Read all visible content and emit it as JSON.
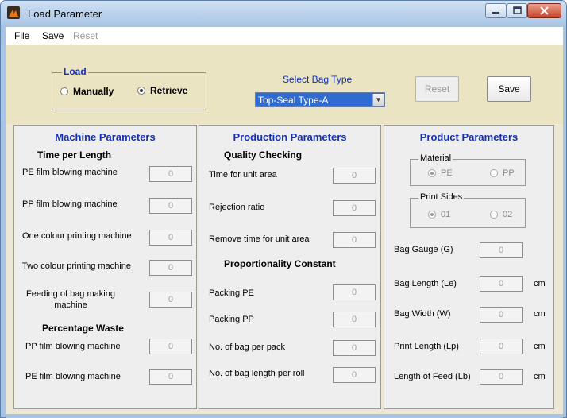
{
  "window": {
    "title": "Load Parameter"
  },
  "menu": {
    "file": "File",
    "save": "Save",
    "reset": "Reset"
  },
  "load": {
    "title": "Load",
    "options": [
      {
        "label": "Manually",
        "selected": false
      },
      {
        "label": "Retrieve",
        "selected": true
      }
    ]
  },
  "bag_type": {
    "label": "Select Bag Type",
    "selected": "Top-Seal Type-A"
  },
  "buttons": {
    "reset": "Reset",
    "save": "Save"
  },
  "machine": {
    "title": "Machine Parameters",
    "time_heading": "Time per Length",
    "time_rows": [
      {
        "label": "PE film blowing machine",
        "value": "0"
      },
      {
        "label": "PP film blowing machine",
        "value": "0"
      },
      {
        "label": "One colour printing machine",
        "value": "0"
      },
      {
        "label": "Two colour printing machine",
        "value": "0"
      },
      {
        "label": "Feeding of bag making machine",
        "value": "0"
      }
    ],
    "waste_heading": "Percentage Waste",
    "waste_rows": [
      {
        "label": "PP film blowing machine",
        "value": "0"
      },
      {
        "label": "PE film blowing machine",
        "value": "0"
      }
    ]
  },
  "production": {
    "title": "Production Parameters",
    "quality_heading": "Quality Checking",
    "quality_rows": [
      {
        "label": "Time for unit area",
        "value": "0"
      },
      {
        "label": "Rejection ratio",
        "value": "0"
      },
      {
        "label": "Remove time for unit area",
        "value": "0"
      }
    ],
    "prop_heading": "Proportionality Constant",
    "prop_rows": [
      {
        "label": "Packing PE",
        "value": "0"
      },
      {
        "label": "Packing PP",
        "value": "0"
      },
      {
        "label": "No. of bag per pack",
        "value": "0"
      },
      {
        "label": "No. of bag length per roll",
        "value": "0"
      }
    ]
  },
  "product": {
    "title": "Product Parameters",
    "material": {
      "title": "Material",
      "options": [
        {
          "label": "PE",
          "selected": true
        },
        {
          "label": "PP",
          "selected": false
        }
      ]
    },
    "print_sides": {
      "title": "Print Sides",
      "options": [
        {
          "label": "01",
          "selected": true
        },
        {
          "label": "02",
          "selected": false
        }
      ]
    },
    "rows": [
      {
        "label": "Bag Gauge (G)",
        "value": "0",
        "unit": ""
      },
      {
        "label": "Bag Length (Le)",
        "value": "0",
        "unit": "cm"
      },
      {
        "label": "Bag Width (W)",
        "value": "0",
        "unit": "cm"
      },
      {
        "label": "Print Length (Lp)",
        "value": "0",
        "unit": "cm"
      },
      {
        "label": "Length of Feed (Lb)",
        "value": "0",
        "unit": "cm"
      }
    ]
  },
  "colors": {
    "accent_blue": "#1530b0",
    "top_area": "#ebe4c2",
    "panel_bg": "#eeeeee",
    "select_bg": "#2f6bd0"
  }
}
